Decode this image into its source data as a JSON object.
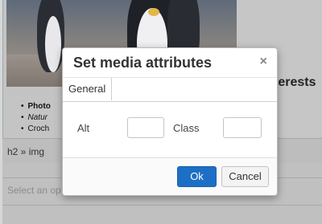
{
  "background": {
    "side_heading": "terests",
    "bullets": [
      "Photo",
      "Natur",
      "Croch"
    ],
    "path": "h2 » img",
    "select_placeholder": "Select an op"
  },
  "dialog": {
    "title": "Set media attributes",
    "close_glyph": "×",
    "tabs": [
      "General"
    ],
    "fields": {
      "alt_label": "Alt",
      "alt_value": "",
      "class_label": "Class",
      "class_value": ""
    },
    "buttons": {
      "ok": "Ok",
      "cancel": "Cancel"
    }
  },
  "colors": {
    "primary_button": "#1d6fc5"
  }
}
